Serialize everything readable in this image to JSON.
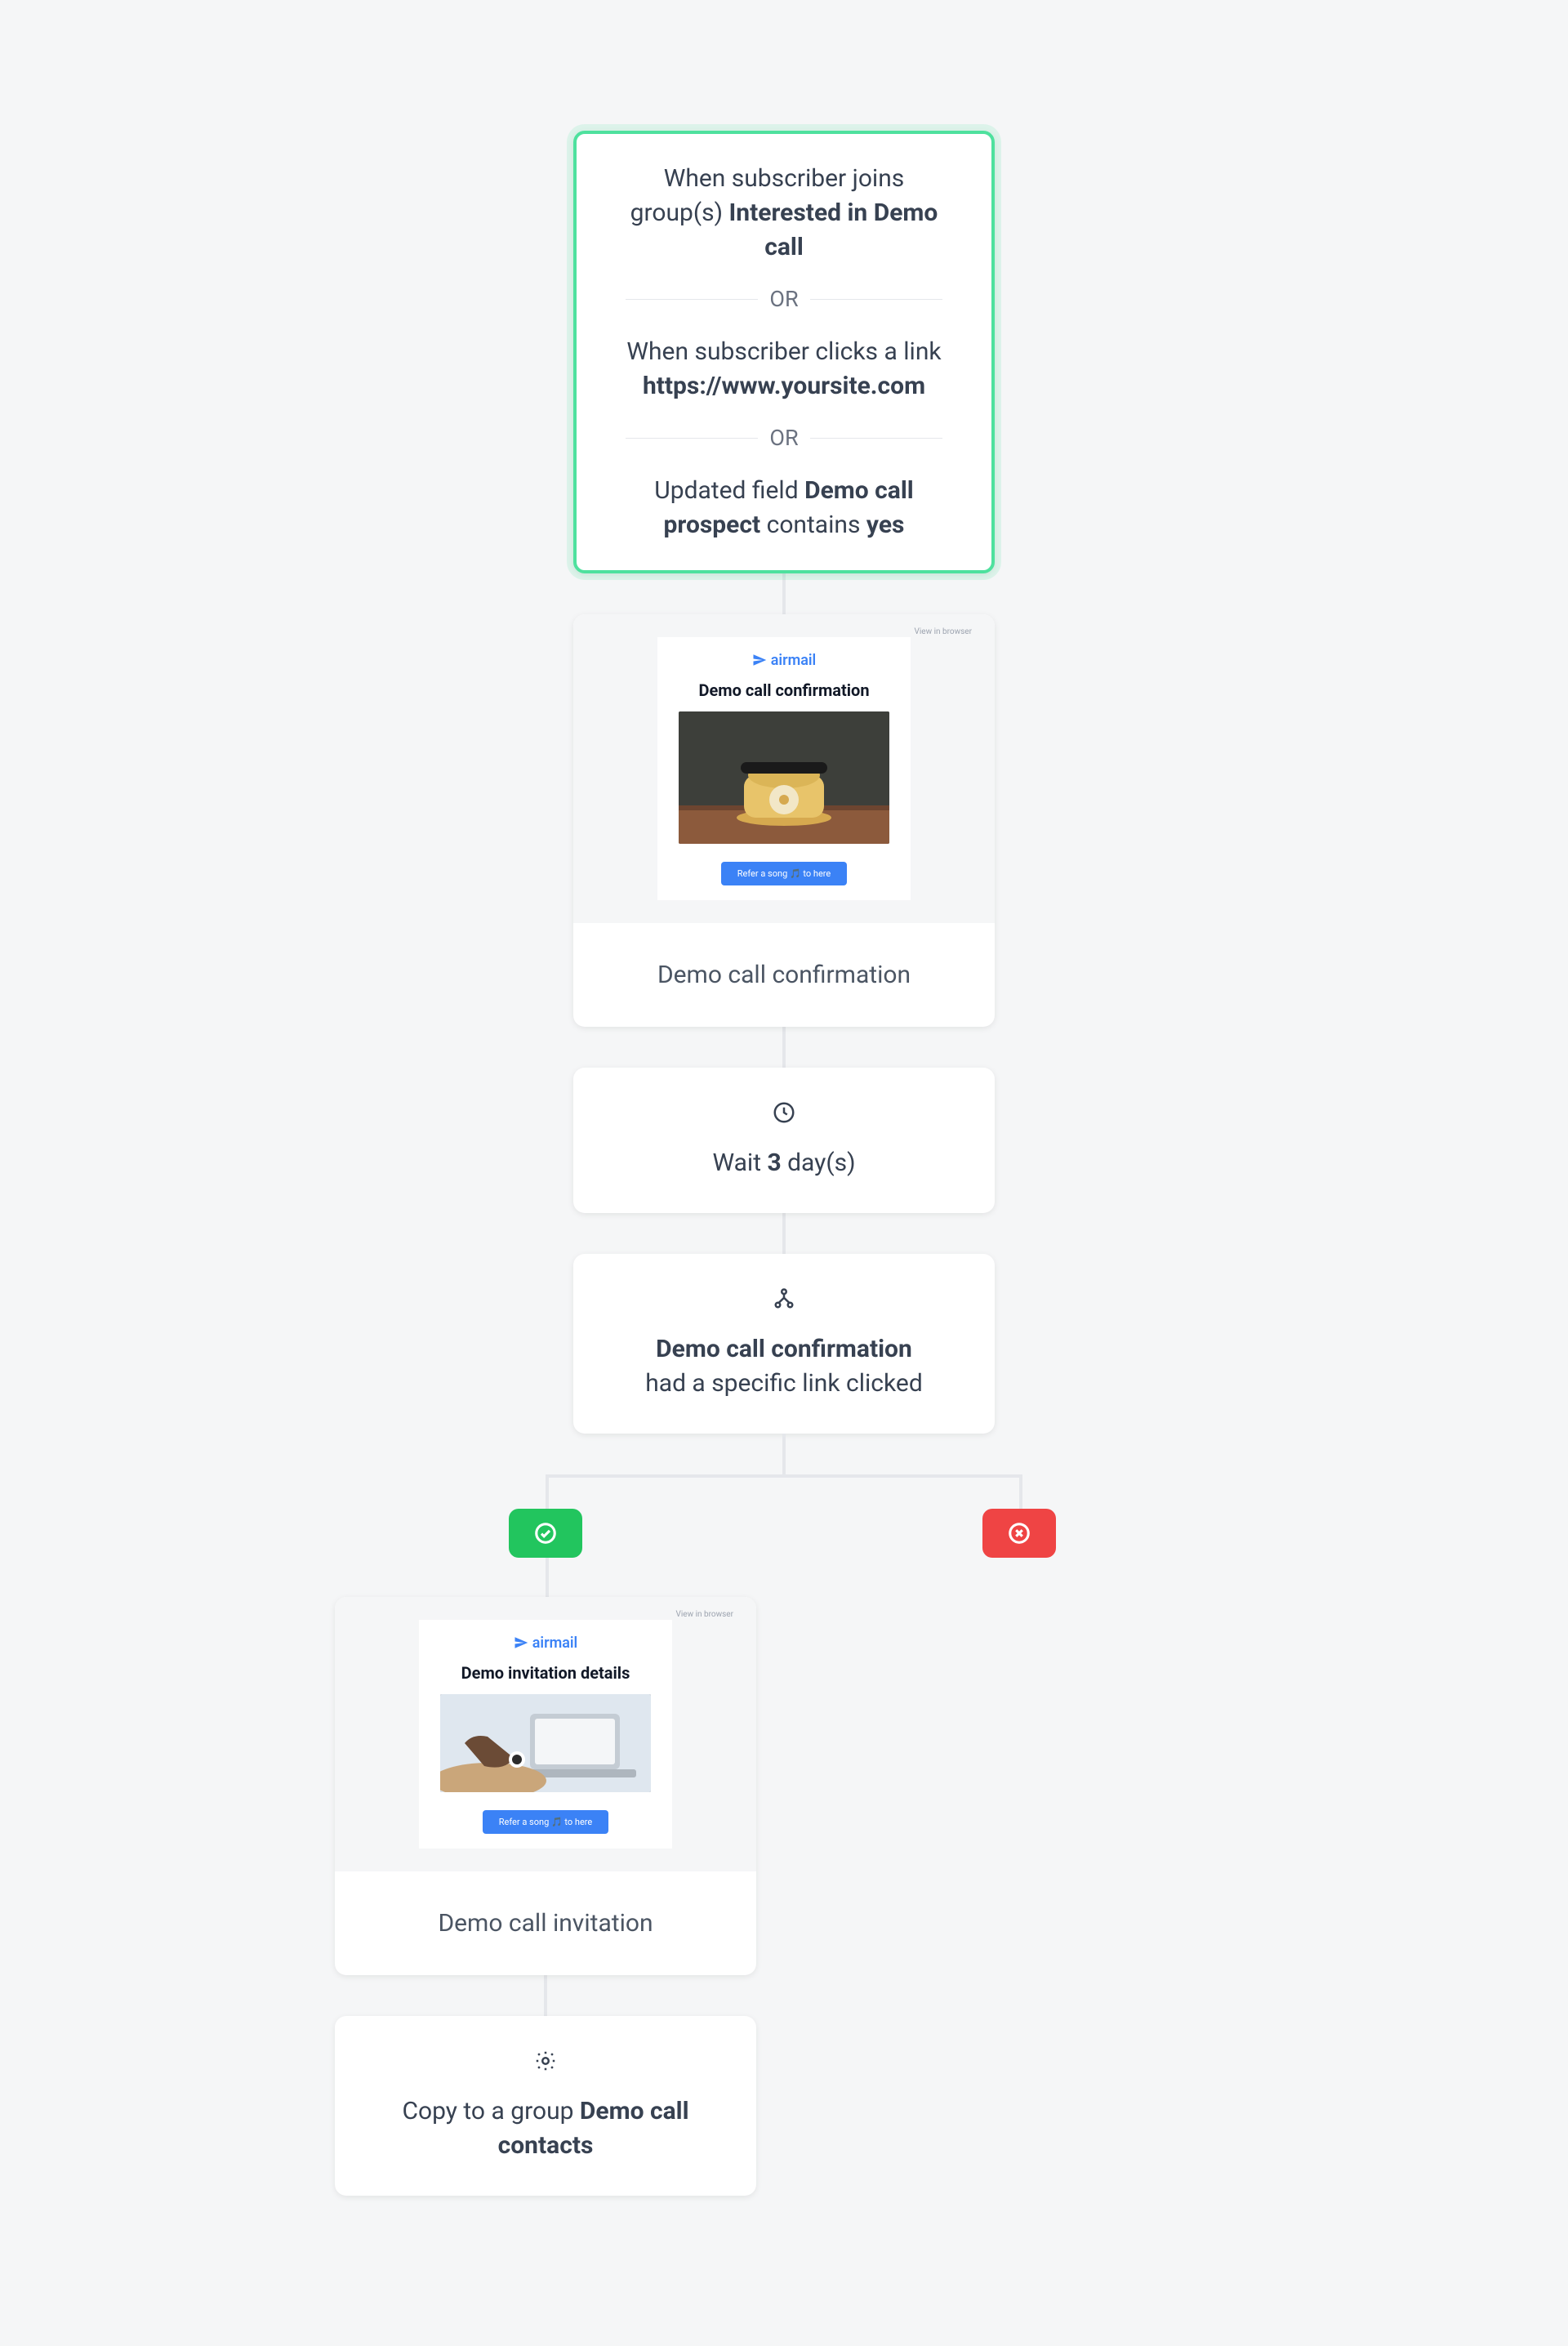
{
  "trigger": {
    "row1_pre": "When subscriber joins group(s) ",
    "row1_bold": "Interested in Demo call",
    "or": "OR",
    "row2_pre": "When subscriber clicks a link ",
    "row2_bold": "https://www.yoursite.com",
    "row3_pre": "Updated field ",
    "row3_bold1": "Demo call prospect",
    "row3_mid": " contains ",
    "row3_bold2": "yes"
  },
  "email1": {
    "view_browser": "View in browser",
    "logo": "airmail",
    "title": "Demo call confirmation",
    "button": "Refer a song 🎵 to here",
    "label": "Demo call confirmation"
  },
  "wait": {
    "pre": "Wait ",
    "bold": "3",
    "post": " day(s)"
  },
  "condition": {
    "bold": "Demo call confirmation",
    "line2": "had a specific link clicked"
  },
  "email2": {
    "view_browser": "View in browser",
    "logo": "airmail",
    "title": "Demo invitation details",
    "button": "Refer a song 🎵 to here",
    "label": "Demo call invitation"
  },
  "action": {
    "pre": "Copy to a group ",
    "bold": "Demo call contacts"
  },
  "colors": {
    "trigger_border": "#4ee19e",
    "yes_badge": "#22c55e",
    "no_badge": "#ef4444",
    "accent": "#3b82f6"
  }
}
